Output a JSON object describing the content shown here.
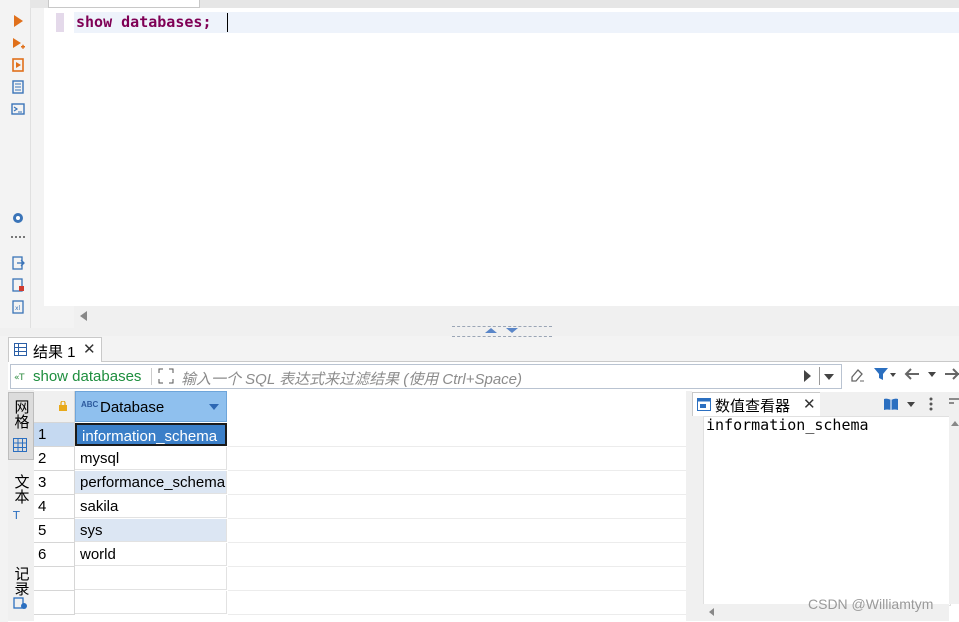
{
  "editor": {
    "sql_keyword": "show databases",
    "sql_terminator": ";"
  },
  "results": {
    "tab_label": "结果 1",
    "filter": {
      "query_label": "show databases",
      "placeholder": "输入一个 SQL 表达式来过滤结果 (使用 Ctrl+Space)"
    },
    "side_tabs": [
      "网格",
      "文本",
      "记录"
    ],
    "grid": {
      "column_header": "Database",
      "type_badge": "ABC",
      "rows": [
        {
          "num": "1",
          "value": "information_schema"
        },
        {
          "num": "2",
          "value": "mysql"
        },
        {
          "num": "3",
          "value": "performance_schema"
        },
        {
          "num": "4",
          "value": "sakila"
        },
        {
          "num": "5",
          "value": "sys"
        },
        {
          "num": "6",
          "value": "world"
        }
      ],
      "selected_row": 1
    },
    "value_viewer": {
      "tab_label": "数值查看器",
      "value": "information_schema"
    }
  },
  "watermark": "CSDN @Williamtym",
  "colors": {
    "header_blue": "#8fc0ee",
    "selected_cell": "#3b7fc8",
    "keyword": "#7f0055",
    "filter_query": "#1e8e3e"
  }
}
